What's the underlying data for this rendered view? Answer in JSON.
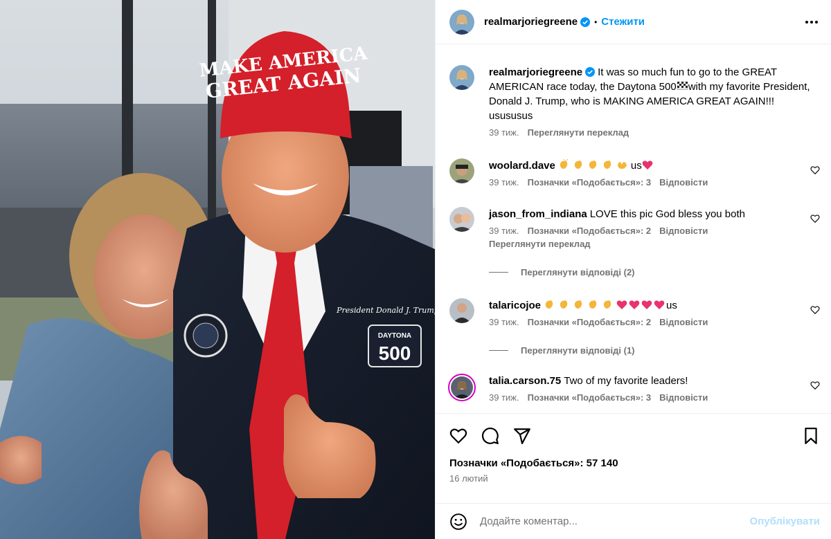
{
  "photo": {
    "hat_line1": "MAKE AMERICA",
    "hat_line2": "GREAT AGAIN",
    "jacket_sign": "President Donald J. Trump",
    "daytona_word": "DAYTONA",
    "daytona_number": "500"
  },
  "header": {
    "username": "realmarjoriegreene",
    "separator": "•",
    "follow_label": "Стежити"
  },
  "caption": {
    "username": "realmarjoriegreene",
    "text_before_flag": "It was so much fun to go to the GREAT AMERICAN race today, the Daytona 500",
    "text_after_flag": "with my favorite President, Donald J. Trump, who is MAKING AMERICA GREAT AGAIN!!! usususus",
    "time": "39 тиж.",
    "translate": "Переглянути переклад"
  },
  "comments": [
    {
      "username": "woolard.dave",
      "text_suffix": "us",
      "time": "39 тиж.",
      "likes": "Позначки «Подобається»: 3",
      "reply": "Відповісти"
    },
    {
      "username": "jason_from_indiana",
      "text": "LOVE this pic God bless you both",
      "time": "39 тиж.",
      "likes": "Позначки «Подобається»: 2",
      "reply": "Відповісти",
      "translate": "Переглянути переклад",
      "view_replies": "Переглянути відповіді (2)"
    },
    {
      "username": "talaricojoe",
      "text_suffix": "us",
      "time": "39 тиж.",
      "likes": "Позначки «Подобається»: 2",
      "reply": "Відповісти",
      "view_replies": "Переглянути відповіді (1)"
    },
    {
      "username": "talia.carson.75",
      "text": "Two of my favorite leaders!",
      "time": "39 тиж.",
      "likes": "Позначки «Подобається»: 3",
      "reply": "Відповісти"
    }
  ],
  "footer": {
    "likes_count": "Позначки «Подобається»: 57 140",
    "date": "16 лютий",
    "comment_placeholder": "Додайте коментар...",
    "post_label": "Опублікувати"
  },
  "colors": {
    "accent": "#0095f6",
    "post_disabled": "#b2dffc",
    "muted_text": "#737373",
    "hat_red": "#d4202a"
  },
  "icons": [
    "verified-badge-icon",
    "more-options-icon",
    "heart-icon",
    "comment-icon",
    "share-icon",
    "bookmark-icon",
    "emoji-icon",
    "clap-emoji",
    "heart-emoji",
    "checkered-flag-emoji"
  ]
}
